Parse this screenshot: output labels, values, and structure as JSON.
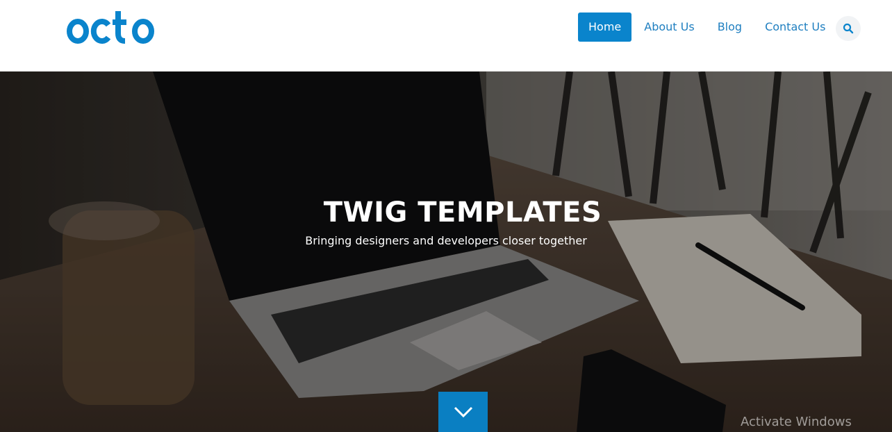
{
  "brand": {
    "logo_text": "octo",
    "color": "#0a84cc"
  },
  "nav": {
    "items": [
      {
        "label": "Home",
        "active": true
      },
      {
        "label": "About Us",
        "active": false
      },
      {
        "label": "Blog",
        "active": false
      },
      {
        "label": "Contact Us",
        "active": false
      }
    ],
    "search_icon": "search-icon"
  },
  "hero": {
    "title": "TWIG TEMPLATES",
    "subtitle": "Bringing designers and developers closer together",
    "scroll_icon": "chevron-down-icon",
    "scroll_button_color": "#0a7fc2"
  },
  "os_watermark": "Activate Windows"
}
